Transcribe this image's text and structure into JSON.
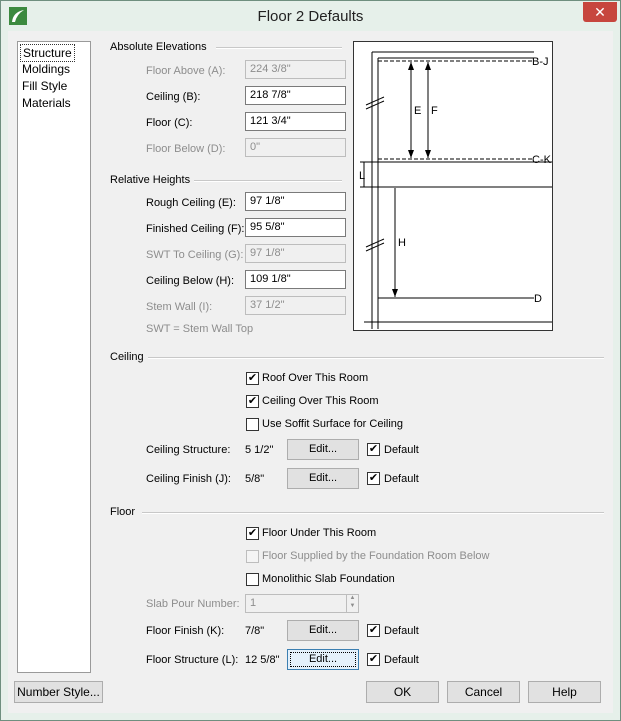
{
  "window": {
    "title": "Floor 2 Defaults",
    "close_glyph": "✕",
    "colors": {
      "titlebar_bg": "#e6f0ea",
      "close_bg": "#c7463e",
      "focus_border": "#3c7fb1"
    }
  },
  "nav": {
    "items": [
      {
        "label": "Structure",
        "selected": true
      },
      {
        "label": "Moldings",
        "selected": false
      },
      {
        "label": "Fill Style",
        "selected": false
      },
      {
        "label": "Materials",
        "selected": false
      }
    ]
  },
  "absolute_elevations": {
    "title": "Absolute Elevations",
    "floor_above": {
      "label": "Floor Above (A):",
      "value": "224 3/8\""
    },
    "ceiling": {
      "label": "Ceiling (B):",
      "value": "218 7/8\""
    },
    "floor": {
      "label": "Floor (C):",
      "value": "121 3/4\""
    },
    "floor_below": {
      "label": "Floor Below (D):",
      "value": "0\""
    }
  },
  "relative_heights": {
    "title": "Relative Heights",
    "rough_ceiling": {
      "label": "Rough Ceiling (E):",
      "value": "97 1/8\""
    },
    "finished_ceiling": {
      "label": "Finished Ceiling (F):",
      "value": "95 5/8\""
    },
    "swt_to_ceiling": {
      "label": "SWT To Ceiling (G):",
      "value": "97 1/8\""
    },
    "ceiling_below": {
      "label": "Ceiling Below (H):",
      "value": "109 1/8\""
    },
    "stem_wall": {
      "label": "Stem Wall (I):",
      "value": "37 1/2\""
    },
    "note": "SWT = Stem Wall Top"
  },
  "diagram": {
    "labels": {
      "bj": "B-J",
      "ck": "C-K",
      "d": "D",
      "e": "E",
      "f": "F",
      "h": "H",
      "l": "L"
    }
  },
  "ceiling": {
    "title": "Ceiling",
    "roof_over": {
      "label": "Roof Over This Room",
      "checked": true
    },
    "ceiling_over": {
      "label": "Ceiling Over This Room",
      "checked": true
    },
    "soffit": {
      "label": "Use Soffit Surface for Ceiling",
      "checked": false
    },
    "structure": {
      "label": "Ceiling Structure:",
      "value": "5 1/2\"",
      "edit": "Edit...",
      "default_label": "Default",
      "default_checked": true
    },
    "finish": {
      "label": "Ceiling Finish (J):",
      "value": "5/8\"",
      "edit": "Edit...",
      "default_label": "Default",
      "default_checked": true
    }
  },
  "floor": {
    "title": "Floor",
    "floor_under": {
      "label": "Floor Under This Room",
      "checked": true
    },
    "supplied": {
      "label": "Floor Supplied by the Foundation Room Below",
      "checked": false
    },
    "monolithic": {
      "label": "Monolithic Slab Foundation",
      "checked": false
    },
    "slab_pour": {
      "label": "Slab Pour Number:",
      "value": "1"
    },
    "finish": {
      "label": "Floor Finish (K):",
      "value": "7/8\"",
      "edit": "Edit...",
      "default_label": "Default",
      "default_checked": true
    },
    "structure": {
      "label": "Floor Structure (L):",
      "value": "12 5/8\"",
      "edit": "Edit...",
      "default_label": "Default",
      "default_checked": true
    }
  },
  "footer": {
    "number_style": "Number Style...",
    "ok": "OK",
    "cancel": "Cancel",
    "help": "Help"
  },
  "glyphs": {
    "check": "✔",
    "spin_up": "▲",
    "spin_down": "▼"
  }
}
